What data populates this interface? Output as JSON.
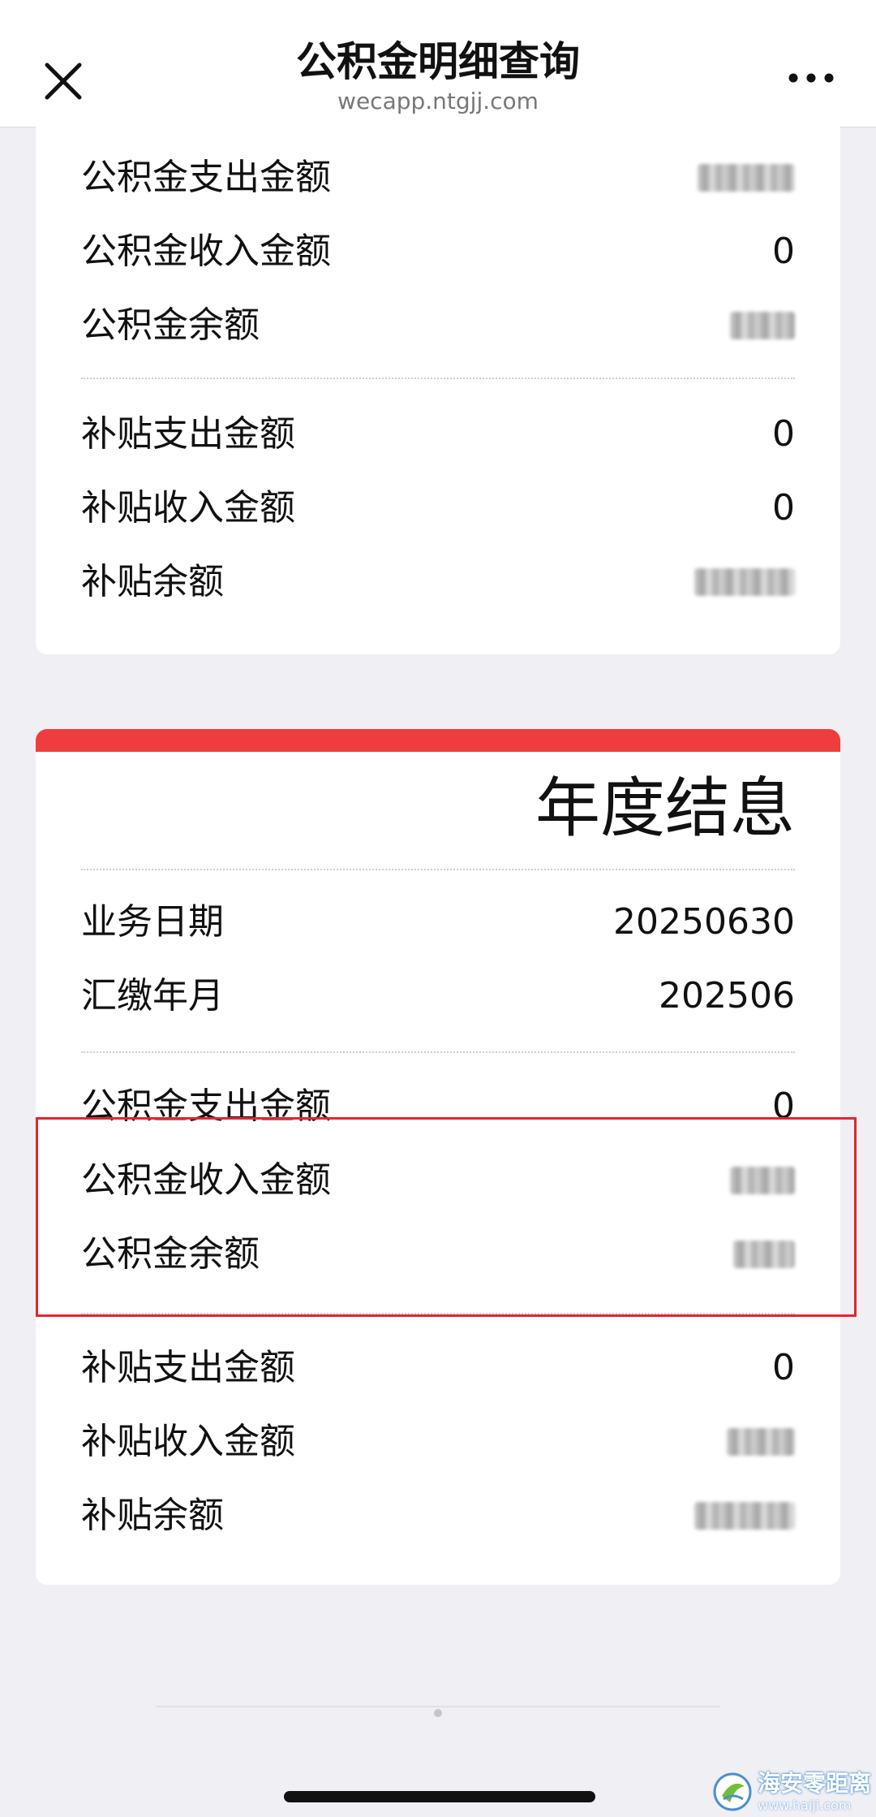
{
  "nav": {
    "title": "公积金明细查询",
    "subtitle": "wecapp.ntgjj.com"
  },
  "card1": {
    "rows_a": [
      {
        "label": "公积金支出金额",
        "value": ""
      },
      {
        "label": "公积金收入金额",
        "value": "0"
      },
      {
        "label": "公积金余额",
        "value": ""
      }
    ],
    "rows_b": [
      {
        "label": "补贴支出金额",
        "value": "0"
      },
      {
        "label": "补贴收入金额",
        "value": "0"
      },
      {
        "label": "补贴余额",
        "value": ""
      }
    ]
  },
  "card2": {
    "title": "年度结息",
    "rows_info": [
      {
        "label": "业务日期",
        "value": "20250630"
      },
      {
        "label": "汇缴年月",
        "value": "202506"
      }
    ],
    "rows_a": [
      {
        "label": "公积金支出金额",
        "value": "0"
      },
      {
        "label": "公积金收入金额",
        "value": ""
      },
      {
        "label": "公积金余额",
        "value": ""
      }
    ],
    "rows_b": [
      {
        "label": "补贴支出金额",
        "value": "0"
      },
      {
        "label": "补贴收入金额",
        "value": ""
      },
      {
        "label": "补贴余额",
        "value": ""
      }
    ]
  },
  "watermark": {
    "name": "海安零距离",
    "url": "www.haiji.com"
  },
  "colors": {
    "accent_red": "#ef3d3f",
    "highlight_border": "#e3262d"
  }
}
